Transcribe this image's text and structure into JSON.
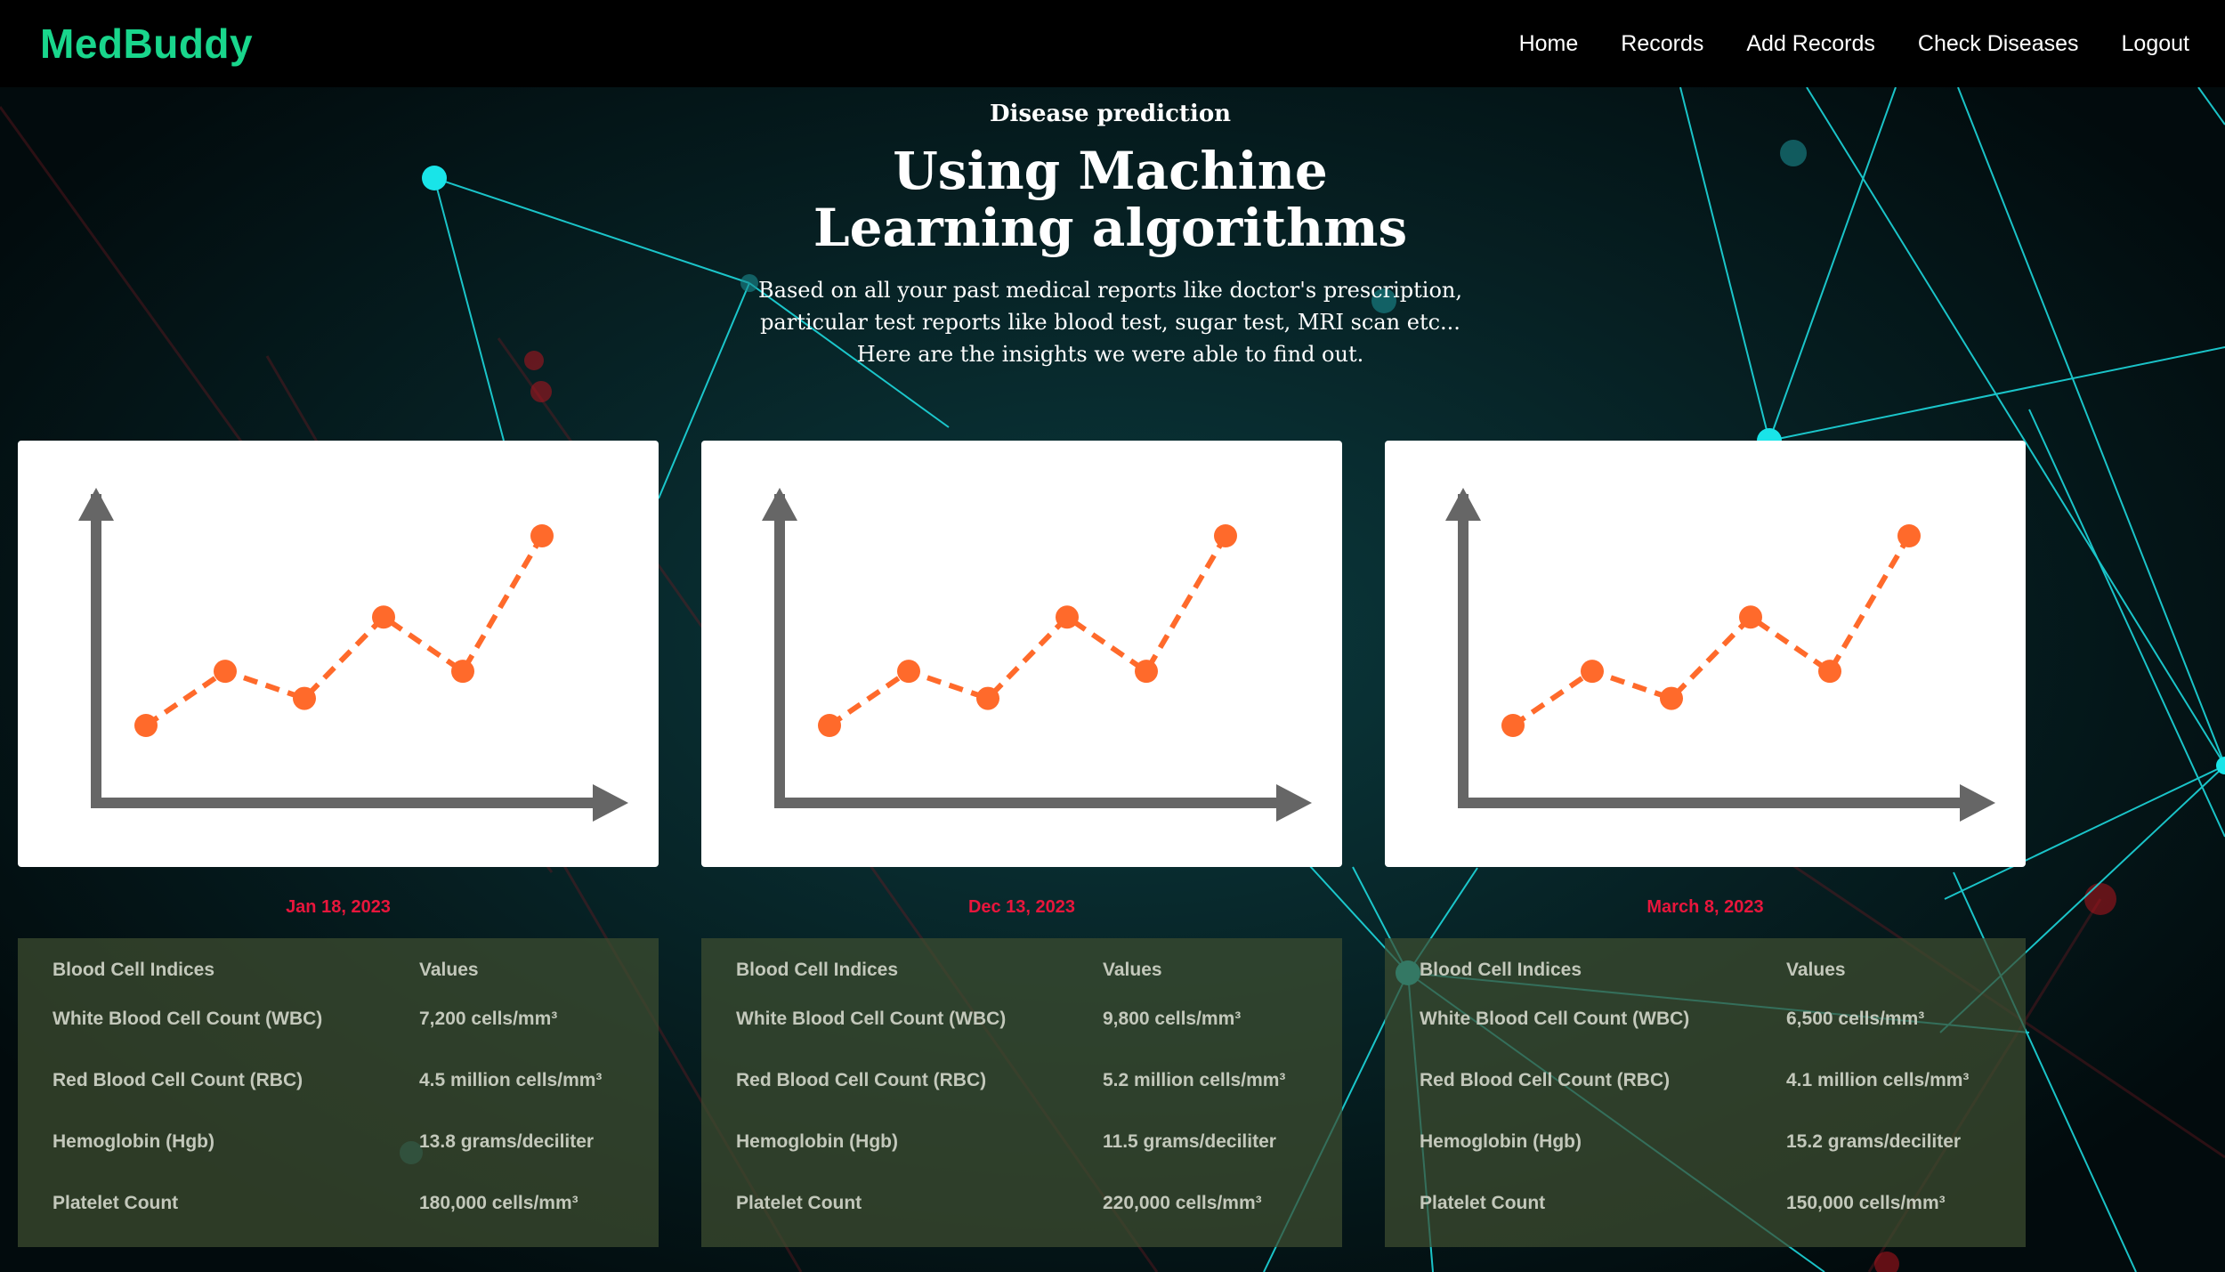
{
  "nav": {
    "brand": "MedBuddy",
    "brand_color": "#19d68c",
    "links": [
      "Home",
      "Records",
      "Add Records",
      "Check Diseases",
      "Logout"
    ]
  },
  "hero": {
    "eyebrow": "Disease prediction",
    "title": "Using Machine Learning algorithms",
    "subtitle": "Based on all your past medical reports like doctor's prescription, particular test reports like blood test, sugar test, MRI scan etc... Here are the insights we were able to find out."
  },
  "theme": {
    "date_color": "#e8163c",
    "chart_axis_color": "#666666",
    "chart_line_color": "#ff6a2b",
    "network_line_color": "#1fe3e8"
  },
  "chart_data": [
    {
      "type": "line",
      "values": [
        1,
        3,
        2,
        5,
        3,
        8
      ]
    },
    {
      "type": "line",
      "values": [
        1,
        3,
        2,
        5,
        3,
        8
      ]
    },
    {
      "type": "line",
      "values": [
        1,
        3,
        2,
        5,
        3,
        8
      ]
    }
  ],
  "cards": [
    {
      "date": "Jan 18, 2023",
      "header": {
        "index": "Blood Cell Indices",
        "value": "Values"
      },
      "rows": [
        {
          "index": "White Blood Cell Count (WBC)",
          "value": "7,200 cells/mm³"
        },
        {
          "index": "Red Blood Cell Count (RBC)",
          "value": "4.5 million cells/mm³"
        },
        {
          "index": "Hemoglobin (Hgb)",
          "value": "13.8 grams/deciliter"
        },
        {
          "index": "Platelet Count",
          "value": "180,000 cells/mm³"
        }
      ]
    },
    {
      "date": "Dec 13, 2023",
      "header": {
        "index": "Blood Cell Indices",
        "value": "Values"
      },
      "rows": [
        {
          "index": "White Blood Cell Count (WBC)",
          "value": "9,800 cells/mm³"
        },
        {
          "index": "Red Blood Cell Count (RBC)",
          "value": "5.2 million cells/mm³"
        },
        {
          "index": "Hemoglobin (Hgb)",
          "value": "11.5 grams/deciliter"
        },
        {
          "index": "Platelet Count",
          "value": "220,000 cells/mm³"
        }
      ]
    },
    {
      "date": "March 8, 2023",
      "header": {
        "index": "Blood Cell Indices",
        "value": "Values"
      },
      "rows": [
        {
          "index": "White Blood Cell Count (WBC)",
          "value": "6,500 cells/mm³"
        },
        {
          "index": "Red Blood Cell Count (RBC)",
          "value": "4.1 million cells/mm³"
        },
        {
          "index": "Hemoglobin (Hgb)",
          "value": "15.2 grams/deciliter"
        },
        {
          "index": "Platelet Count",
          "value": "150,000 cells/mm³"
        }
      ]
    }
  ]
}
